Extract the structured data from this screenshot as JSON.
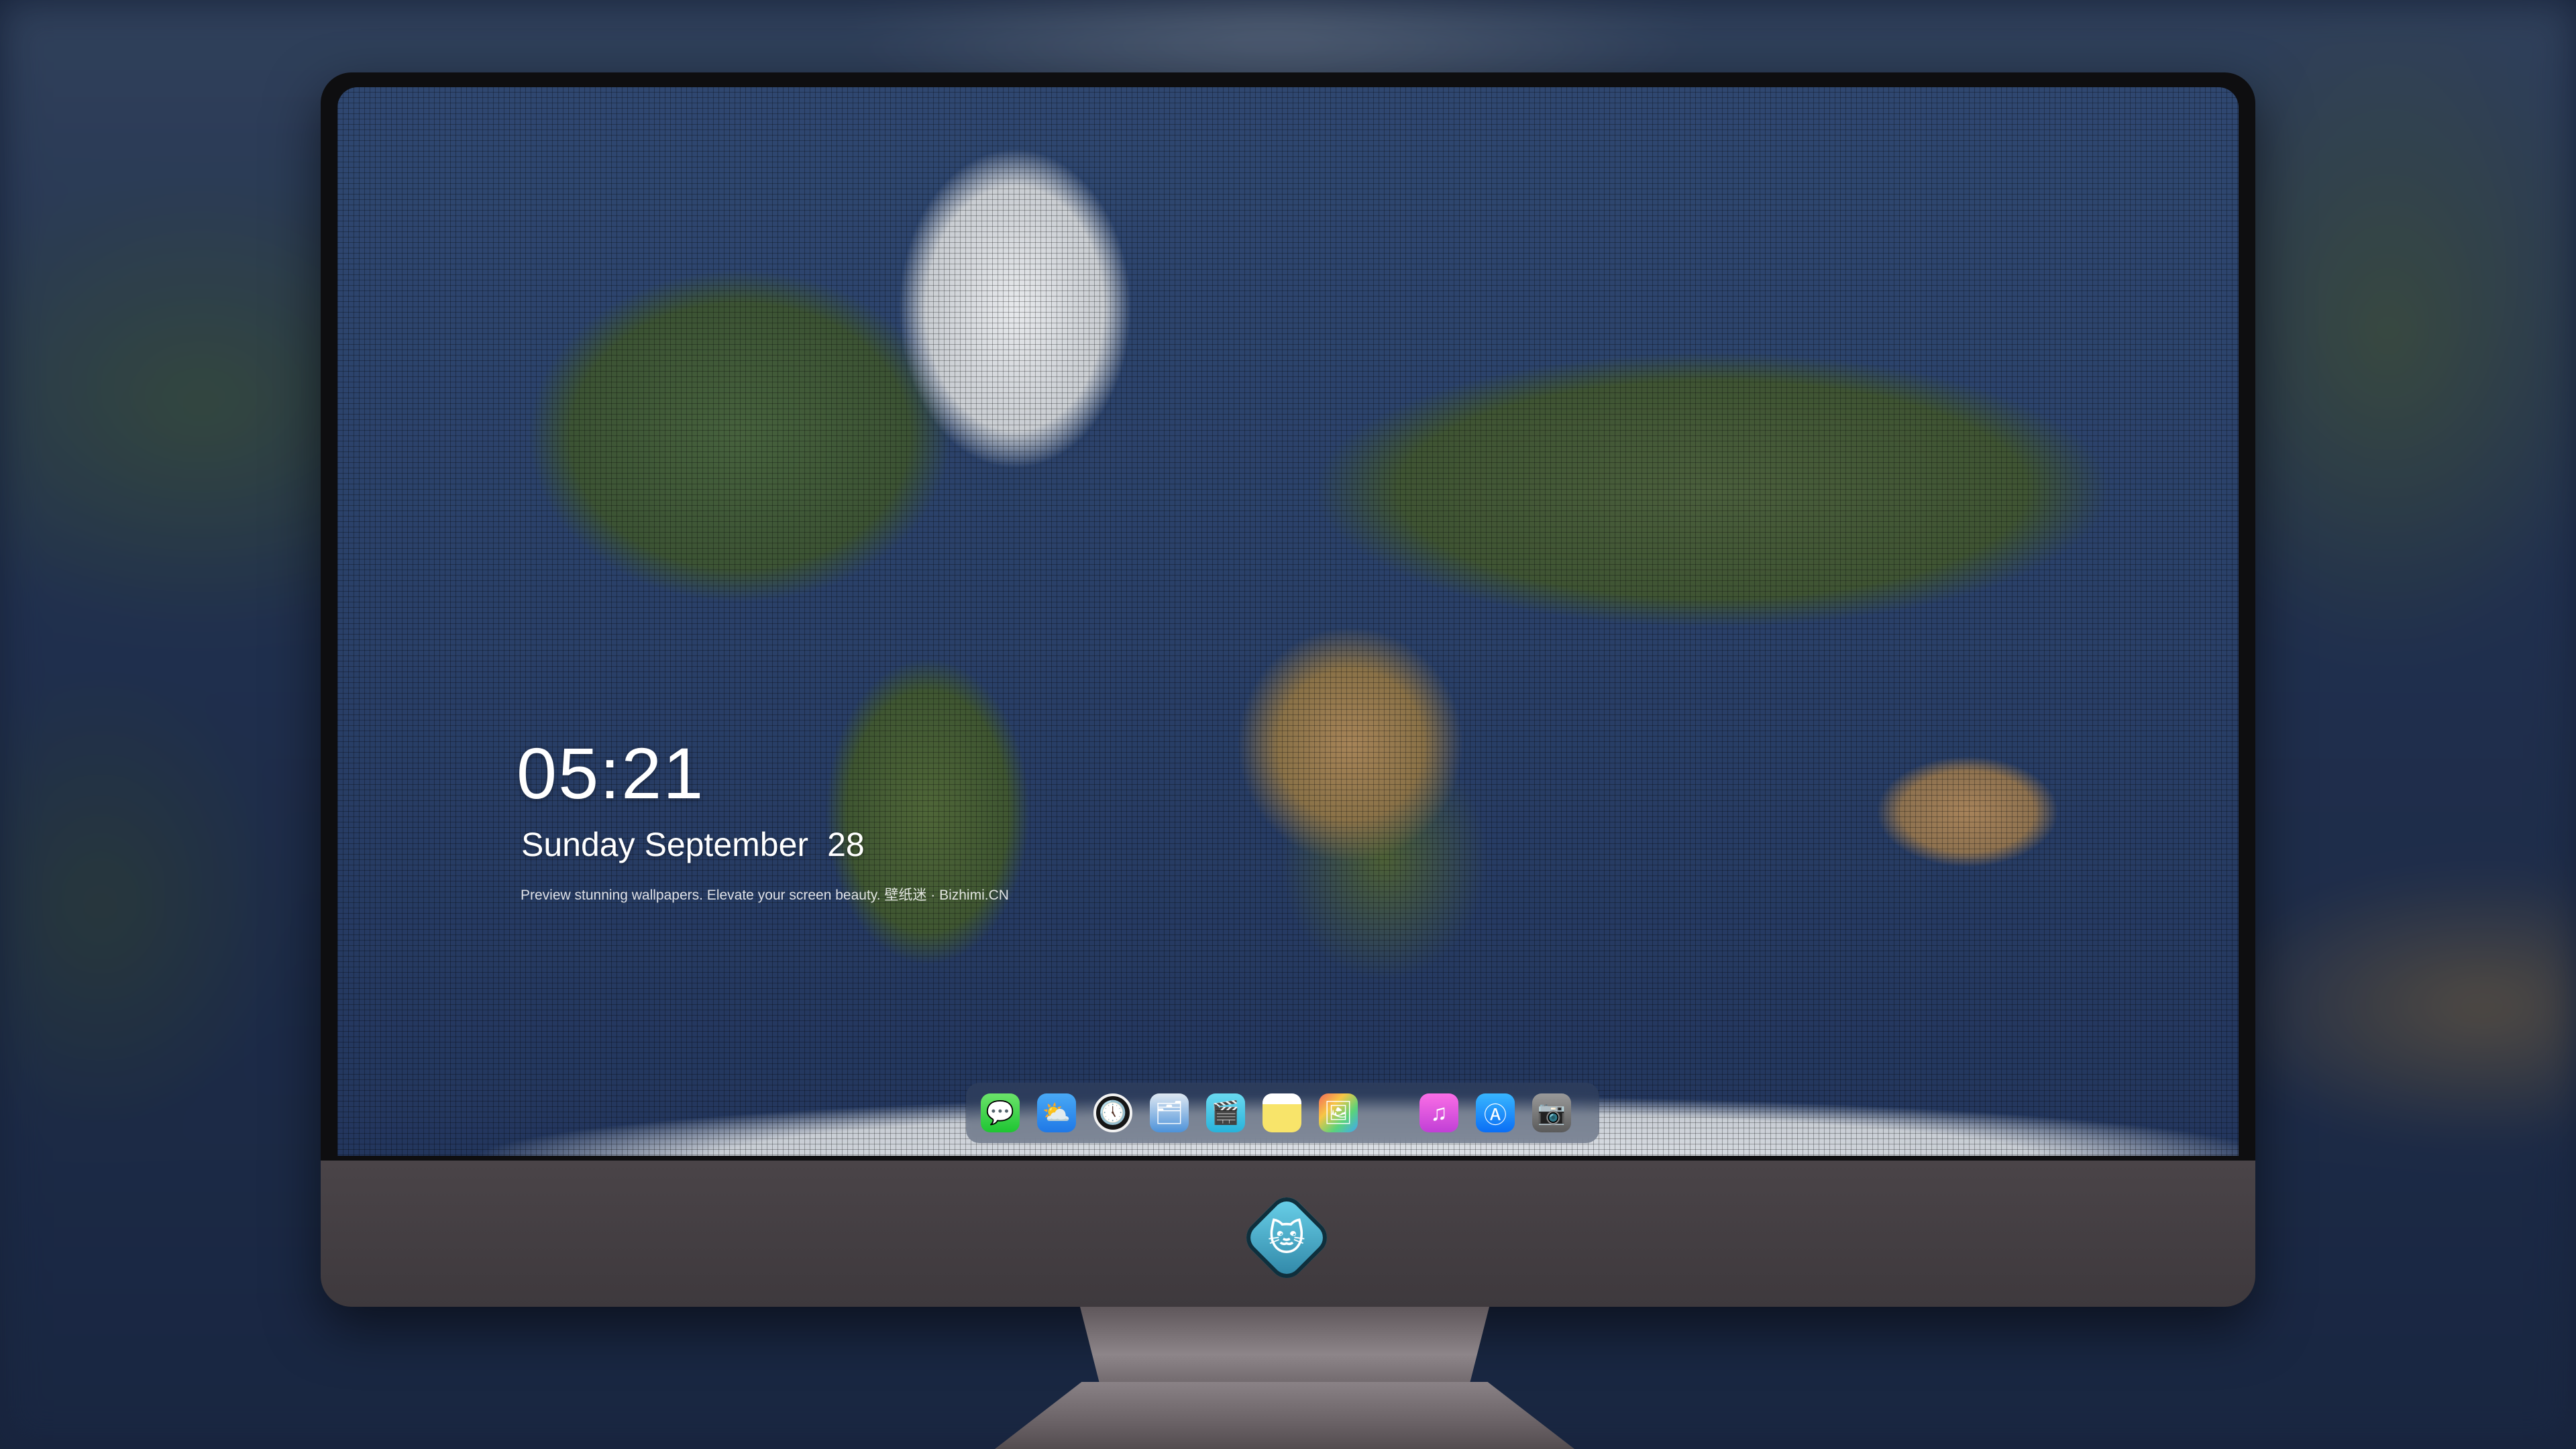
{
  "lockscreen": {
    "time": "05:21",
    "weekday_month": "Sunday September",
    "day": "28",
    "tagline": "Preview stunning wallpapers. Elevate your screen beauty. 壁纸迷 · Bizhimi.CN"
  },
  "dock": {
    "items": [
      {
        "name": "Messages",
        "icon": "messages-icon",
        "glyph": "💬"
      },
      {
        "name": "Weather",
        "icon": "weather-icon",
        "glyph": "⛅"
      },
      {
        "name": "Clock",
        "icon": "clock-icon",
        "glyph": "🕔"
      },
      {
        "name": "Finder",
        "icon": "finder-icon",
        "glyph": "🗂"
      },
      {
        "name": "Clips",
        "icon": "clips-icon",
        "glyph": "🎬"
      },
      {
        "name": "Notes",
        "icon": "notes-icon",
        "glyph": ""
      },
      {
        "name": "Photos",
        "icon": "photos-icon",
        "glyph": "🖼"
      },
      {
        "name": "Music",
        "icon": "music-icon",
        "glyph": "♫"
      },
      {
        "name": "App Store",
        "icon": "app-store-icon",
        "glyph": "Ⓐ"
      },
      {
        "name": "Camera",
        "icon": "camera-icon",
        "glyph": "📷"
      }
    ]
  },
  "chin": {
    "logo_icon": "mascot-logo-icon",
    "logo_glyph": "🐱"
  },
  "colors": {
    "screen_ocean": "#2a4068",
    "bezel": "#0e0e10",
    "chin": "#433e42",
    "text": "#ffffff"
  }
}
